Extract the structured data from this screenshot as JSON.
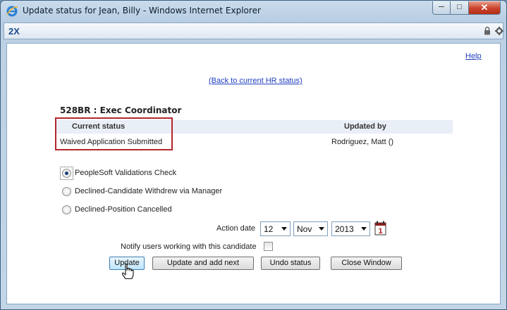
{
  "window": {
    "title": "Update status for Jean, Billy - Windows Internet Explorer",
    "logo_text": "2X",
    "icons": [
      "ie-icon",
      "minimize-icon",
      "maximize-icon",
      "close-icon",
      "lock-icon",
      "gear-icon"
    ]
  },
  "links": {
    "help": "Help",
    "back": "(Back to current HR status)"
  },
  "requisition": {
    "title": "528BR :  Exec Coordinator"
  },
  "status_table": {
    "headers": [
      "Current status",
      "Updated by"
    ],
    "current_status": "Waived Application Submitted",
    "updated_by": "Rodriguez, Matt ()"
  },
  "status_options": [
    {
      "label": "PeopleSoft Validations Check",
      "selected": true
    },
    {
      "label": "Declined-Candidate Withdrew via Manager",
      "selected": false
    },
    {
      "label": "Declined-Position Cancelled",
      "selected": false
    }
  ],
  "action_date": {
    "label": "Action date",
    "day": "12",
    "month": "Nov",
    "year": "2013",
    "calendar_icon_label": "1"
  },
  "notify": {
    "label": "Notify users working with this candidate",
    "checked": false
  },
  "buttons": {
    "update": "Update",
    "update_next": "Update and add next",
    "undo": "Undo status",
    "close_window": "Close Window"
  },
  "colors": {
    "highlight_box": "#b3272d",
    "link": "#1f3fbf",
    "header_bg": "#e9eef7"
  }
}
